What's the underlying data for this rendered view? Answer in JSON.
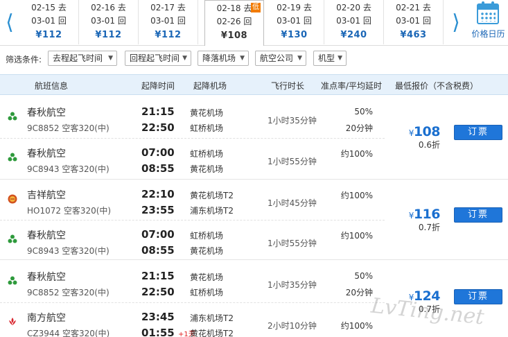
{
  "date_strip": {
    "prev_arrow": "⟨",
    "next_arrow": "⟩",
    "cells": [
      {
        "out": "02-15",
        "out_tag": "去",
        "ret": "03-01",
        "ret_tag": "回",
        "price": "¥112"
      },
      {
        "out": "02-16",
        "out_tag": "去",
        "ret": "03-01",
        "ret_tag": "回",
        "price": "¥112"
      },
      {
        "out": "02-17",
        "out_tag": "去",
        "ret": "03-01",
        "ret_tag": "回",
        "price": "¥112"
      },
      {
        "out": "02-18",
        "out_tag": "去",
        "ret": "02-26",
        "ret_tag": "回",
        "price": "¥108",
        "badge": "低"
      },
      {
        "out": "02-19",
        "out_tag": "去",
        "ret": "03-01",
        "ret_tag": "回",
        "price": "¥130"
      },
      {
        "out": "02-20",
        "out_tag": "去",
        "ret": "03-01",
        "ret_tag": "回",
        "price": "¥240"
      },
      {
        "out": "02-21",
        "out_tag": "去",
        "ret": "03-01",
        "ret_tag": "回",
        "price": "¥463"
      }
    ],
    "calendar_label": "价格日历",
    "calendar_icon": "calendar-icon"
  },
  "filters": {
    "label": "筛选条件:",
    "options": [
      "去程起飞时间",
      "回程起飞时间",
      "降落机场",
      "航空公司",
      "机型"
    ]
  },
  "table_header": {
    "flight_info": "航班信息",
    "times": "起降时间",
    "airports": "起降机场",
    "duration": "飞行时长",
    "ontime": "准点率/平均延时",
    "price": "最低报价（不含税费）"
  },
  "groups": [
    {
      "price_yen": "¥",
      "price": "108",
      "discount": "0.6折",
      "book_label": "订票",
      "flights": [
        {
          "airline": "春秋航空",
          "flight_no": "9C8852 空客320(中)",
          "dep_time": "21:15",
          "arr_time": "22:50",
          "next_day": "",
          "dep_airport": "黄花机场",
          "arr_airport": "虹桥机场",
          "duration": "1小时35分钟",
          "ontime": "50%",
          "delay": "20分钟",
          "logo": "spring-airlines-logo-icon"
        },
        {
          "airline": "春秋航空",
          "flight_no": "9C8943 空客320(中)",
          "dep_time": "07:00",
          "arr_time": "08:55",
          "next_day": "",
          "dep_airport": "虹桥机场",
          "arr_airport": "黄花机场",
          "duration": "1小时55分钟",
          "ontime": "约100%",
          "delay": "",
          "logo": "spring-airlines-logo-icon"
        }
      ]
    },
    {
      "price_yen": "¥",
      "price": "116",
      "discount": "0.7折",
      "book_label": "订票",
      "flights": [
        {
          "airline": "吉祥航空",
          "flight_no": "HO1072 空客320(中)",
          "dep_time": "22:10",
          "arr_time": "23:55",
          "next_day": "",
          "dep_airport": "黄花机场T2",
          "arr_airport": "浦东机场T2",
          "duration": "1小时45分钟",
          "ontime": "约100%",
          "delay": "",
          "logo": "juneyao-airlines-logo-icon"
        },
        {
          "airline": "春秋航空",
          "flight_no": "9C8943 空客320(中)",
          "dep_time": "07:00",
          "arr_time": "08:55",
          "next_day": "",
          "dep_airport": "虹桥机场",
          "arr_airport": "黄花机场",
          "duration": "1小时55分钟",
          "ontime": "约100%",
          "delay": "",
          "logo": "spring-airlines-logo-icon"
        }
      ]
    },
    {
      "price_yen": "¥",
      "price": "124",
      "discount": "0.7折",
      "book_label": "订票",
      "flights": [
        {
          "airline": "春秋航空",
          "flight_no": "9C8852 空客320(中)",
          "dep_time": "21:15",
          "arr_time": "22:50",
          "next_day": "",
          "dep_airport": "黄花机场",
          "arr_airport": "虹桥机场",
          "duration": "1小时35分钟",
          "ontime": "50%",
          "delay": "20分钟",
          "logo": "spring-airlines-logo-icon"
        },
        {
          "airline": "南方航空",
          "flight_no": "CZ3944 空客320(中)",
          "dep_time": "23:45",
          "arr_time": "01:55",
          "next_day": "+1天",
          "dep_airport": "浦东机场T2",
          "arr_airport": "黄花机场T2",
          "duration": "2小时10分钟",
          "ontime": "约100%",
          "delay": "",
          "logo": "china-southern-logo-icon"
        }
      ]
    }
  ],
  "watermark": "LvTing.net",
  "colors": {
    "accent_blue": "#1a66b6",
    "button_blue": "#1f76d9",
    "header_bg": "#e6f1fb",
    "badge_orange": "#f27b00",
    "spring_green": "#2e9a3c"
  }
}
